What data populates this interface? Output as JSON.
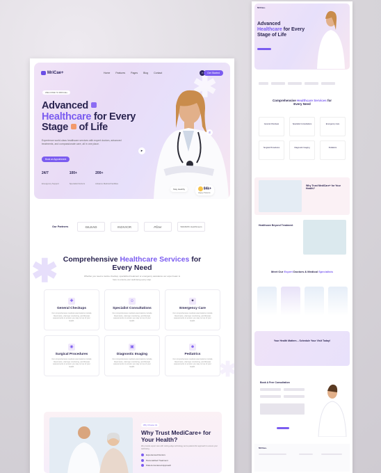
{
  "brand": {
    "name": "MriCae+",
    "accent": "#7b5cf0",
    "dark": "#2a2450"
  },
  "nav": {
    "links": [
      "Home",
      "Features",
      "Pages",
      "Blog",
      "Contact"
    ],
    "cta": "Get Started",
    "search_icon": "search-icon"
  },
  "hero": {
    "tag": "WELCOME TO MRICAE+",
    "title_l1": "Advanced",
    "title_l2a": "Healthcare",
    "title_l2b": " for Every",
    "title_l3a": "Stage",
    "title_l3b": " of Life",
    "desc": "Experience world-class healthcare services with expert doctors, advanced treatments, and compassionate care, all in one place.",
    "button": "Book an Appointment",
    "stats": [
      {
        "value": "24/7",
        "label": "Emergency Support"
      },
      {
        "value": "100+",
        "label": "Specialist Doctors"
      },
      {
        "value": "200+",
        "label": "Advance Medical Facilities"
      }
    ],
    "float_label": "Stay Healthy",
    "patients_value": "84k+",
    "patients_label": "Happy Patients"
  },
  "partners": {
    "label": "Our Partners",
    "items": [
      "GILEAD",
      "INDIVIOR",
      "Pfizer",
      "SIEMENS Healthineers"
    ]
  },
  "services": {
    "heading_a": "Comprehensive ",
    "heading_b": "Healthcare Services",
    "heading_c": " for",
    "heading_d": "Every Need",
    "desc": "Whether you need a routine checkup, specialized treatment or emergency assistance our expert team is here to ensure your well-being every step.",
    "items": [
      {
        "title": "General Checkups",
        "icon": "stethoscope-icon",
        "desc": "Our comprehensive medical examinations include blood tests, vital sign monitoring, and lifestyle assessments to ensure you stay on top of your health."
      },
      {
        "title": "Specialist Consultations",
        "icon": "user-doctor-icon",
        "desc": "Our comprehensive medical examinations include blood tests, vital sign monitoring, and lifestyle assessments to ensure you stay on top of your health."
      },
      {
        "title": "Emergency Care",
        "icon": "star-icon",
        "desc": "Our comprehensive medical examinations include blood tests, vital sign monitoring, and lifestyle assessments to ensure you stay on top of your health."
      },
      {
        "title": "Surgical Procedures",
        "icon": "eye-icon",
        "desc": "Our comprehensive medical examinations include blood tests, vital sign monitoring, and lifestyle assessments to ensure you stay on top of your health."
      },
      {
        "title": "Diagnostic Imaging",
        "icon": "image-icon",
        "desc": "Our comprehensive medical examinations include blood tests, vital sign monitoring, and lifestyle assessments to ensure you stay on top of your health."
      },
      {
        "title": "Pediatrics",
        "icon": "baby-icon",
        "desc": "Our comprehensive medical examinations include blood tests, vital sign monitoring, and lifestyle assessments to ensure you stay on top of your health."
      }
    ]
  },
  "trust": {
    "tag": "Why Choose Us",
    "title": "Why Trust MediCare+ for Your Health?",
    "desc": "We provide expert care with cutting-edge technology and a patient-first approach to ensure your well-being.",
    "points": [
      "Experienced Doctors",
      "Personalized Treatment",
      "Patient-Centered Approach"
    ]
  },
  "side": {
    "beyond": "Healthcare Beyond Treatment",
    "experts_a": "Meet Our ",
    "experts_b": "Expert",
    "experts_c": " Doctors & Medical ",
    "experts_d": "Specialists",
    "cta_title": "Your Health Matters – Schedule Your Visit Today!",
    "consult": "Book A Free Consultation"
  }
}
